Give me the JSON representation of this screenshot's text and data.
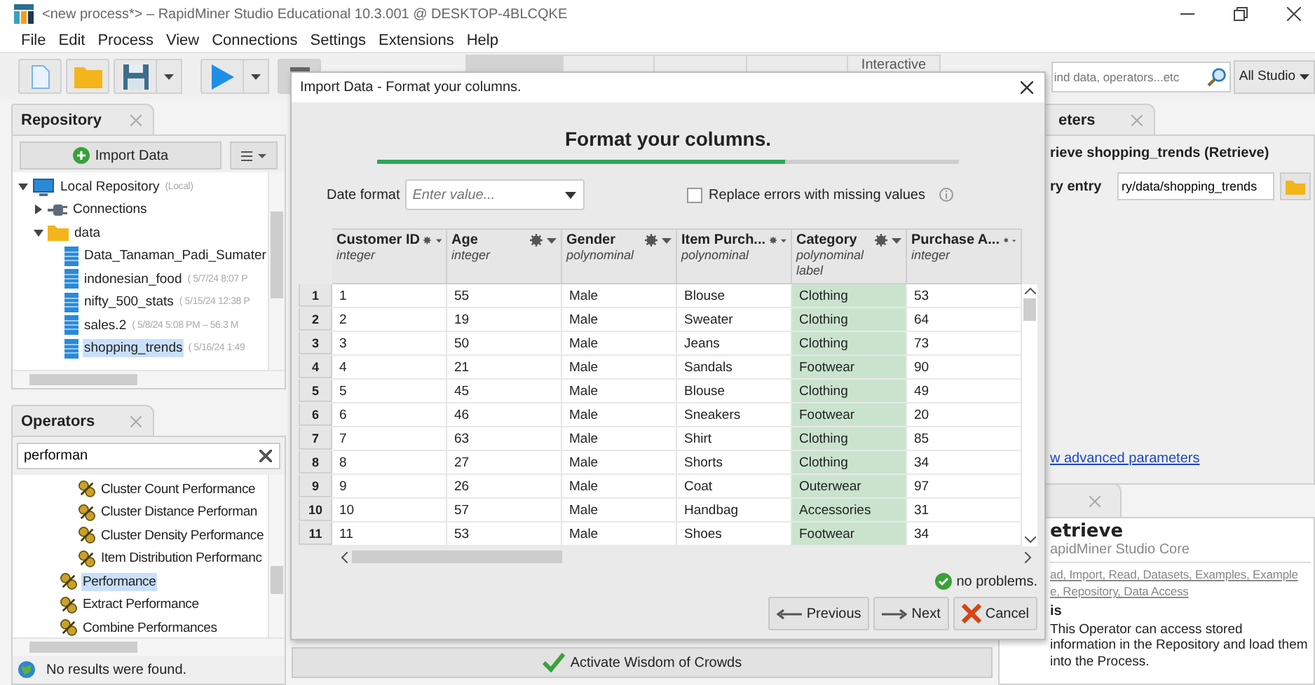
{
  "window": {
    "title": "<new process*> – RapidMiner Studio Educational 10.3.001 @ DESKTOP-4BLCQKE"
  },
  "menu": [
    "File",
    "Edit",
    "Process",
    "View",
    "Connections",
    "Settings",
    "Extensions",
    "Help"
  ],
  "perspectives": [
    {
      "selected": true
    },
    {
      "selected": false
    },
    {
      "selected": false
    },
    {
      "selected": false
    },
    {
      "label": "Interactive",
      "selected": false
    }
  ],
  "global_search": {
    "placeholder": "ind data, operators...etc",
    "scope": "All Studio"
  },
  "repository": {
    "tab": "Repository",
    "import_button": "Import Data",
    "tree": [
      {
        "label": "Local Repository",
        "meta": "(Local)",
        "kind": "repo",
        "expanded": true,
        "selected": false,
        "children": [
          {
            "label": "Connections",
            "kind": "connections",
            "expanded": false,
            "selected": false
          },
          {
            "label": "data",
            "kind": "folder",
            "expanded": true,
            "selected": false,
            "children": [
              {
                "label": "Data_Tanaman_Padi_Sumater",
                "kind": "dataset",
                "selected": false
              },
              {
                "label": "indonesian_food",
                "meta": "( 5/7/24 8:07 P",
                "kind": "dataset",
                "selected": false
              },
              {
                "label": "nifty_500_stats",
                "meta": "( 5/15/24 12:38 P",
                "kind": "dataset",
                "selected": false
              },
              {
                "label": "sales.2",
                "meta": "( 5/8/24 5:08 PM – 56.3 M",
                "kind": "dataset",
                "selected": false
              },
              {
                "label": "shopping_trends",
                "meta": "( 5/16/24 1:49",
                "kind": "dataset",
                "selected": true
              }
            ]
          }
        ]
      }
    ]
  },
  "operators": {
    "tab": "Operators",
    "search": "performan",
    "results": [
      {
        "children": [
          {
            "label": "Cluster Count Performance",
            "selected": false
          },
          {
            "label": "Cluster Distance Performan",
            "selected": false
          },
          {
            "label": "Cluster Density Performance",
            "selected": false
          },
          {
            "label": "Item Distribution Performanc",
            "selected": false
          }
        ]
      },
      {
        "label": "Performance",
        "selected": true
      },
      {
        "label": "Extract Performance",
        "selected": false
      },
      {
        "label": "Combine Performances",
        "selected": false
      }
    ],
    "status": "No results were found."
  },
  "process": {
    "wisdom_button": "Activate Wisdom of Crowds"
  },
  "parameters": {
    "tab": "eters",
    "operator": "rieve shopping_trends (Retrieve)",
    "params": [
      {
        "label": "ry entry",
        "value": "ry/data/shopping_trends"
      }
    ],
    "advanced_link": "w advanced parameters"
  },
  "help": {
    "title": "etrieve",
    "source": "apidMiner Studio Core",
    "tag_lines": [
      "ad, Import, Read, Datasets, Examples, Example",
      "e, Repository, Data Access"
    ],
    "section": "is",
    "description": "This Operator can access stored information in the Repository and load them into the Process."
  },
  "dialog": {
    "title": "Import Data - Format your columns.",
    "heading": "Format your columns.",
    "progress": {
      "level": 0.7
    },
    "date_format": {
      "label": "Date format",
      "placeholder": "Enter value..."
    },
    "replace_errors": {
      "label": "Replace errors with missing values",
      "checked": false
    },
    "columns": [
      {
        "name": "Customer ID",
        "type": "integer"
      },
      {
        "name": "Age",
        "type": "integer"
      },
      {
        "name": "Gender",
        "type": "polynominal"
      },
      {
        "name": "Item Purch...",
        "type": "polynominal"
      },
      {
        "name": "Category",
        "type": "polynominal",
        "role": "label"
      },
      {
        "name": "Purchase A...",
        "type": "integer"
      }
    ],
    "rows": [
      {
        "number": "1",
        "cells": [
          "1",
          "55",
          "Male",
          "Blouse",
          "Clothing",
          "53"
        ]
      },
      {
        "number": "2",
        "cells": [
          "2",
          "19",
          "Male",
          "Sweater",
          "Clothing",
          "64"
        ]
      },
      {
        "number": "3",
        "cells": [
          "3",
          "50",
          "Male",
          "Jeans",
          "Clothing",
          "73"
        ]
      },
      {
        "number": "4",
        "cells": [
          "4",
          "21",
          "Male",
          "Sandals",
          "Footwear",
          "90"
        ]
      },
      {
        "number": "5",
        "cells": [
          "5",
          "45",
          "Male",
          "Blouse",
          "Clothing",
          "49"
        ]
      },
      {
        "number": "6",
        "cells": [
          "6",
          "46",
          "Male",
          "Sneakers",
          "Footwear",
          "20"
        ]
      },
      {
        "number": "7",
        "cells": [
          "7",
          "63",
          "Male",
          "Shirt",
          "Clothing",
          "85"
        ]
      },
      {
        "number": "8",
        "cells": [
          "8",
          "27",
          "Male",
          "Shorts",
          "Clothing",
          "34"
        ]
      },
      {
        "number": "9",
        "cells": [
          "9",
          "26",
          "Male",
          "Coat",
          "Outerwear",
          "97"
        ]
      },
      {
        "number": "10",
        "cells": [
          "10",
          "57",
          "Male",
          "Handbag",
          "Accessories",
          "31"
        ]
      },
      {
        "number": "11",
        "cells": [
          "11",
          "53",
          "Male",
          "Shoes",
          "Footwear",
          "34"
        ]
      }
    ],
    "status": "no problems.",
    "buttons": [
      {
        "label": "Previous",
        "kind": "previous"
      },
      {
        "label": "Next",
        "kind": "next"
      },
      {
        "label": "Cancel",
        "kind": "cancel"
      }
    ]
  }
}
